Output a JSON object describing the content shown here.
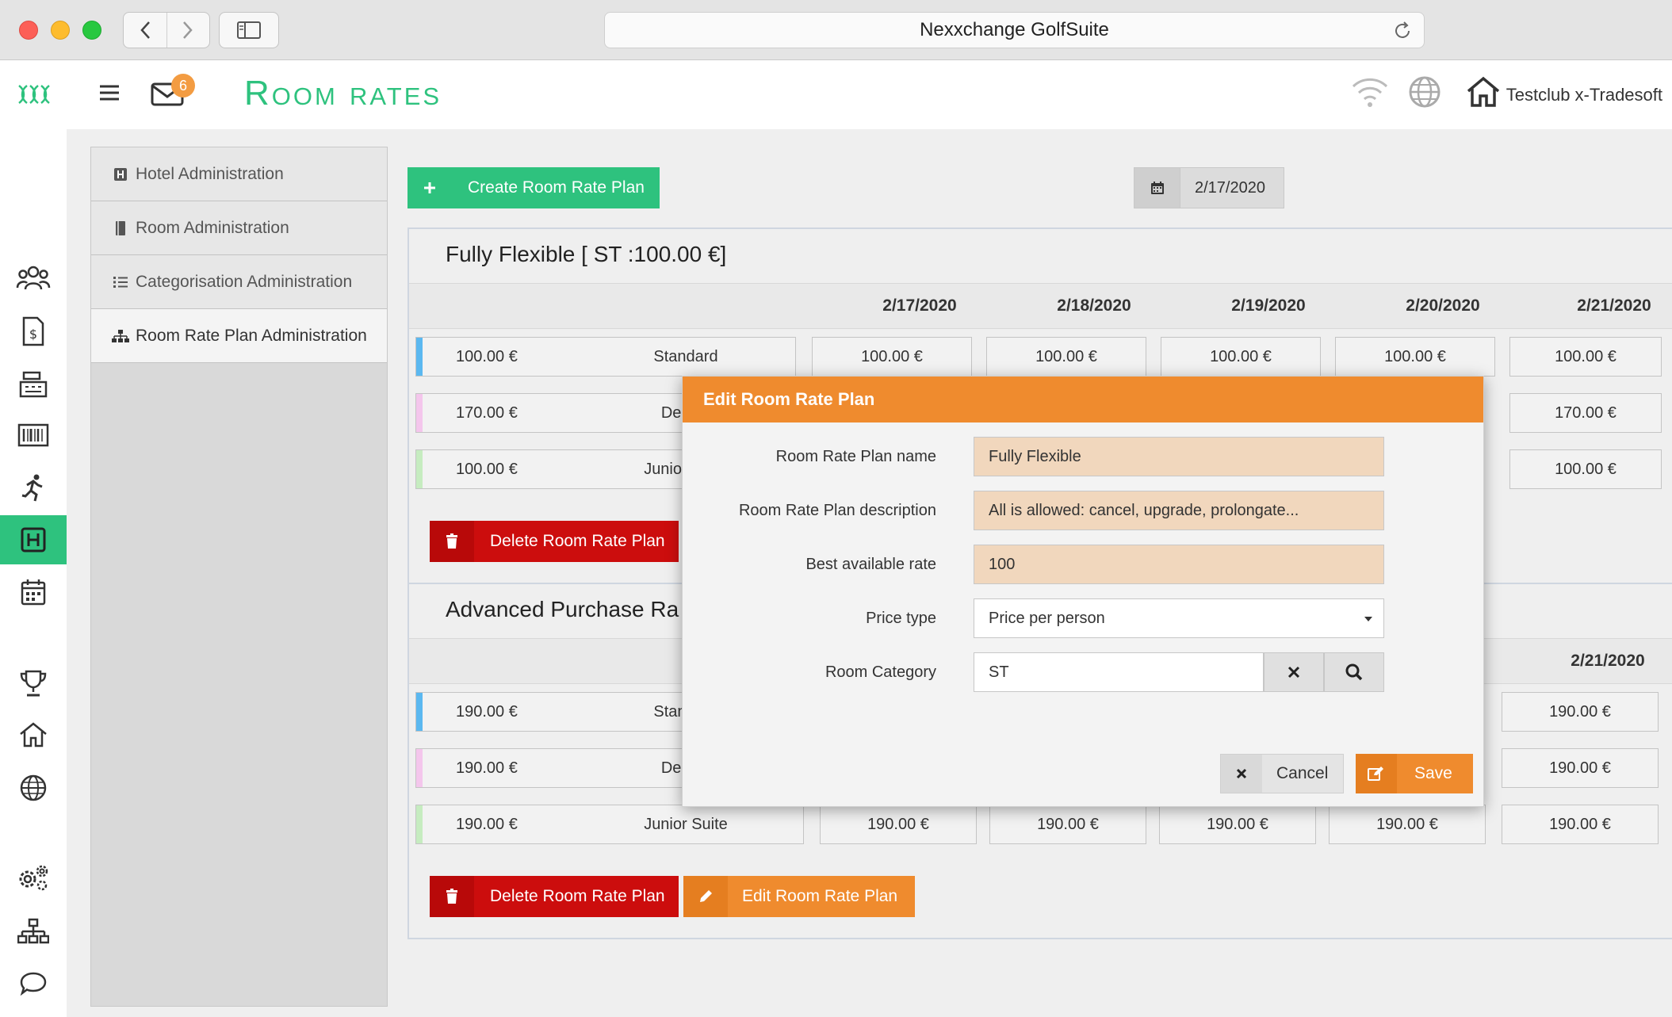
{
  "browser": {
    "title": "Nexxchange GolfSuite"
  },
  "header": {
    "title": "Room rates",
    "mail_count": "6",
    "club_name": "Testclub x-Tradesoft"
  },
  "admin_menu": {
    "items": [
      {
        "label": "Hotel Administration",
        "icon": "hotel-icon"
      },
      {
        "label": "Room Administration",
        "icon": "book-icon"
      },
      {
        "label": "Categorisation Administration",
        "icon": "list-icon"
      },
      {
        "label": "Room Rate Plan Administration",
        "icon": "sitemap-icon"
      }
    ]
  },
  "toolbar": {
    "create_label": "Create Room Rate Plan",
    "date": "2/17/2020"
  },
  "plans": [
    {
      "title": "Fully Flexible [ ST :100.00 €]",
      "dates": [
        "2/17/2020",
        "2/18/2020",
        "2/19/2020",
        "2/20/2020",
        "2/21/2020"
      ],
      "rows": [
        {
          "price": "100.00 €",
          "category": "Standard",
          "color": "#5bb8f0",
          "values": [
            "100.00 €",
            "100.00 €",
            "100.00 €",
            "100.00 €",
            "100.00 €"
          ]
        },
        {
          "price": "170.00 €",
          "category": "Deluxe",
          "color": "#f4c6ec",
          "values": [
            "",
            "",
            "",
            "",
            "170.00 €"
          ]
        },
        {
          "price": "100.00 €",
          "category": "Junior Suite",
          "color": "#c6ecc0",
          "values": [
            "",
            "",
            "",
            "",
            "100.00 €"
          ]
        }
      ],
      "delete_label": "Delete Room Rate Plan"
    },
    {
      "title": "Advanced Purchase Ra",
      "dates": [
        "2/21/2020"
      ],
      "rows": [
        {
          "price": "190.00 €",
          "category": "Standard",
          "color": "#5bb8f0",
          "values": [
            "190.00 €"
          ]
        },
        {
          "price": "190.00 €",
          "category": "Deluxe",
          "color": "#f4c6ec",
          "values": [
            "190.00 €"
          ]
        },
        {
          "price": "190.00 €",
          "category": "Junior Suite",
          "color": "#c6ecc0",
          "values": [
            "190.00 €",
            "190.00 €",
            "190.00 €",
            "190.00 €",
            "190.00 €"
          ]
        }
      ],
      "delete_label": "Delete Room Rate Plan",
      "edit_label": "Edit Room Rate Plan"
    }
  ],
  "modal": {
    "title": "Edit Room Rate Plan",
    "fields": {
      "name_label": "Room Rate Plan name",
      "name_value": "Fully Flexible",
      "desc_label": "Room Rate Plan description",
      "desc_value": "All is allowed: cancel, upgrade, prolongate...",
      "bar_label": "Best available rate",
      "bar_value": "100",
      "price_type_label": "Price type",
      "price_type_value": "Price per person",
      "category_label": "Room Category",
      "category_value": "ST"
    },
    "cancel_label": "Cancel",
    "save_label": "Save"
  },
  "colors": {
    "brand_green": "#2ec27e",
    "orange": "#ef8b2e",
    "red": "#cc0d0d"
  }
}
